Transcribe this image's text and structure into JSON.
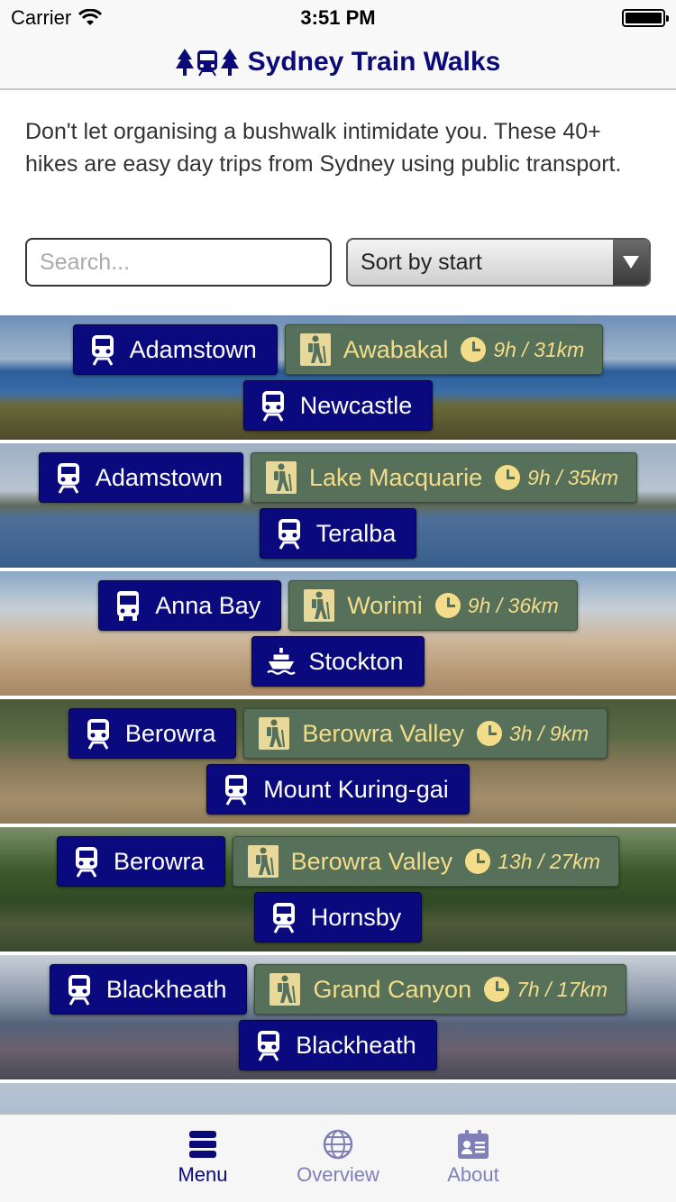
{
  "status": {
    "carrier": "Carrier",
    "time": "3:51 PM"
  },
  "app": {
    "title": "Sydney Train Walks"
  },
  "intro": "Don't let organising a bushwalk intimidate you. These 40+ hikes are easy day trips from Sydney using public transport.",
  "search": {
    "placeholder": "Search..."
  },
  "sort": {
    "selected": "Sort by start"
  },
  "walks": [
    {
      "start": "Adamstown",
      "start_mode": "train",
      "name": "Awabakal",
      "duration": "9h / 31km",
      "end": "Newcastle",
      "end_mode": "train"
    },
    {
      "start": "Adamstown",
      "start_mode": "train",
      "name": "Lake Macquarie",
      "duration": "9h / 35km",
      "end": "Teralba",
      "end_mode": "train"
    },
    {
      "start": "Anna Bay",
      "start_mode": "bus",
      "name": "Worimi",
      "duration": "9h / 36km",
      "end": "Stockton",
      "end_mode": "ferry"
    },
    {
      "start": "Berowra",
      "start_mode": "train",
      "name": "Berowra Valley",
      "duration": "3h / 9km",
      "end": "Mount Kuring-gai",
      "end_mode": "train"
    },
    {
      "start": "Berowra",
      "start_mode": "train",
      "name": "Berowra Valley",
      "duration": "13h / 27km",
      "end": "Hornsby",
      "end_mode": "train"
    },
    {
      "start": "Blackheath",
      "start_mode": "train",
      "name": "Grand Canyon",
      "duration": "7h / 17km",
      "end": "Blackheath",
      "end_mode": "train"
    }
  ],
  "tabs": [
    {
      "label": "Menu",
      "icon": "menu-icon",
      "active": true
    },
    {
      "label": "Overview",
      "icon": "globe-icon",
      "active": false
    },
    {
      "label": "About",
      "icon": "contact-card-icon",
      "active": false
    }
  ],
  "colors": {
    "brand": "#0a0a78",
    "walk_chip": "#567059",
    "walk_text": "#f3dd8a"
  }
}
